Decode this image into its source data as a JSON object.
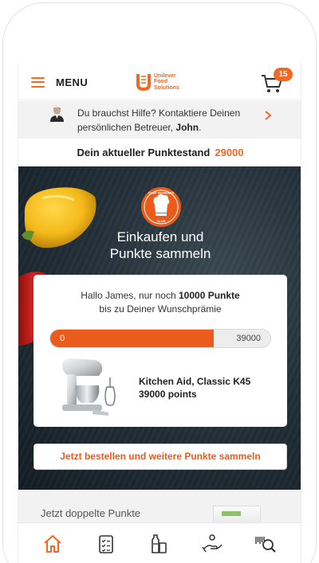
{
  "header": {
    "menu_label": "MENU",
    "logo_text": [
      "Unilever",
      "Food",
      "Solutions"
    ],
    "cart_count": "15",
    "cart_icon": "shopping-cart-icon",
    "menu_icon": "hamburger-menu-icon"
  },
  "help_banner": {
    "text_before": "Du brauchst Hilfe? Kontaktiere Deinen persönlichen Betreuer, ",
    "contact_name": "John",
    "text_after": ".",
    "chevron_icon": "chevron-right-icon"
  },
  "points": {
    "label": "Dein aktueller Punktestand",
    "value": "29000"
  },
  "hero": {
    "badge_text_top": "CHEF REWARDS",
    "badge_text_bottom": "CLUB",
    "title_line1": "Einkaufen und",
    "title_line2": "Punkte sammeln"
  },
  "reward_card": {
    "msg_before": "Hallo James, nur noch ",
    "msg_points": "10000 Punkte",
    "msg_after": "bis zu Deiner Wunschprämie",
    "progress_min": "0",
    "progress_max": "39000",
    "progress_fraction": 0.7436,
    "product_name": "Kitchen Aid, Classic K45",
    "product_points": "39000 points"
  },
  "cta": {
    "order_label": "Jetzt bestellen und weitere Punkte sammeln"
  },
  "teaser": {
    "text": "Jetzt doppelte Punkte"
  },
  "tabbar": {
    "tabs": [
      "home-icon",
      "checklist-icon",
      "products-icon",
      "hand-coin-icon",
      "barcode-search-icon"
    ]
  },
  "colors": {
    "accent": "#f26722",
    "progress": "#ea5b1c"
  }
}
